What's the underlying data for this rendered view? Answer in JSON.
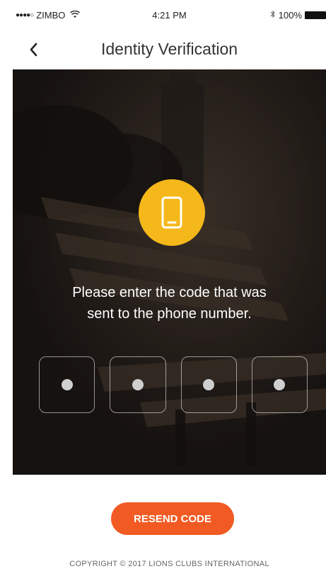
{
  "status_bar": {
    "signal": "●●●●○",
    "carrier": "ZIMBO",
    "time": "4:21 PM",
    "bluetooth": "∦",
    "battery": "100%"
  },
  "nav": {
    "title": "Identity Verification"
  },
  "hero": {
    "message_line1": "Please enter the code that was",
    "message_line2": "sent to the phone number."
  },
  "code_boxes": [
    "",
    "",
    "",
    ""
  ],
  "actions": {
    "resend_label": "RESEND CODE"
  },
  "footer": {
    "copyright": "COPYRIGHT © 2017 LIONS CLUBS INTERNATIONAL"
  },
  "colors": {
    "accent_orange": "#f15a22",
    "phone_icon_circle": "#f5b81a"
  },
  "icons": {
    "back": "chevron-left-icon",
    "phone": "smartphone-icon",
    "wifi": "wifi-icon",
    "bluetooth": "bluetooth-icon",
    "battery": "battery-icon"
  }
}
